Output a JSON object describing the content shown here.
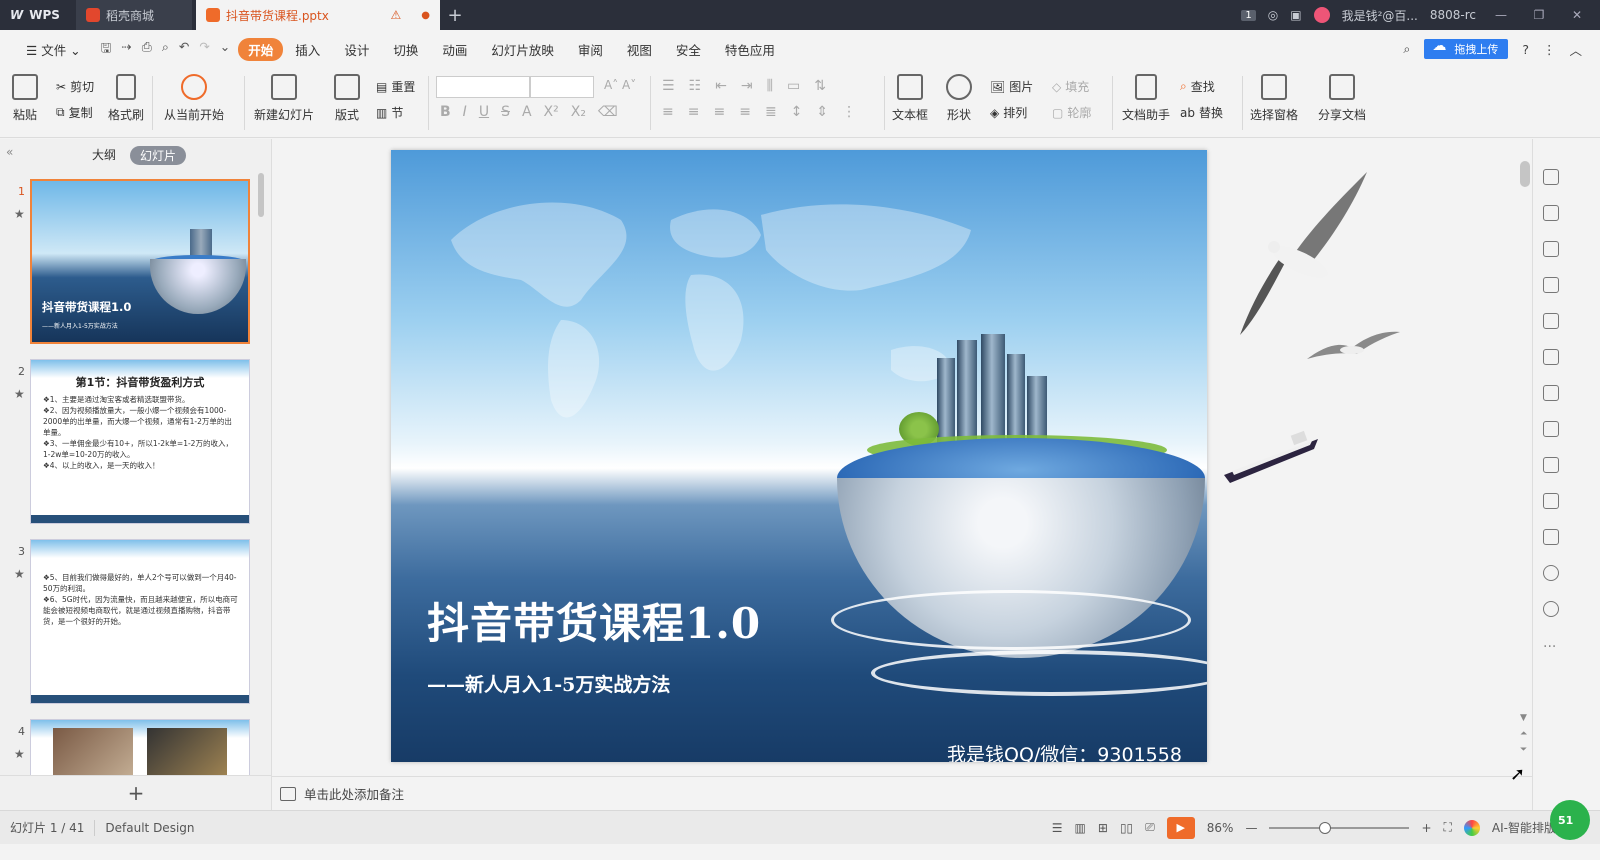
{
  "titlebar": {
    "wps_label": "WPS",
    "tabs": [
      {
        "label": "稻壳商城"
      },
      {
        "label": "抖音带货课程.pptx"
      }
    ],
    "badge": "1",
    "user": "我是钱²@百...",
    "user_id": "8808-rc"
  },
  "menu": {
    "file": "文件",
    "items": [
      "开始",
      "插入",
      "设计",
      "切换",
      "动画",
      "幻灯片放映",
      "审阅",
      "视图",
      "安全",
      "特色应用"
    ],
    "upload": "拖拽上传"
  },
  "ribbon": {
    "paste": "粘贴",
    "cut": "剪切",
    "copy": "复制",
    "format_painter": "格式刷",
    "from_current": "从当前开始",
    "new_slide": "新建幻灯片",
    "layout": "版式",
    "reset": "重置",
    "section": "节",
    "textbox": "文本框",
    "shape": "形状",
    "picture": "图片",
    "fill": "填充",
    "arrange": "排列",
    "outline": "轮廓",
    "doc_assistant": "文档助手",
    "find": "查找",
    "replace": "替换",
    "select_pane": "选择窗格",
    "share_doc": "分享文档"
  },
  "left_panel": {
    "tab_outline": "大纲",
    "tab_slides": "幻灯片",
    "thumbs": [
      {
        "num": "1",
        "title": "抖音带货课程1.0",
        "sub": "——新人月入1-5万实战方法"
      },
      {
        "num": "2",
        "title": "第1节：抖音带货盈利方式",
        "lines": [
          "❖1、主要是通过淘宝客或者精选联盟带货。",
          "❖2、因为视频播放量大，一般小爆一个视频会有1000-2000单的出单量，而大爆一个视频，通常有1-2万单的出单量。",
          "❖3、一单佣金最少有10+，所以1-2k单=1-2万的收入，1-2w单=10-20万的收入。",
          "❖4、以上的收入，是一天的收入！"
        ]
      },
      {
        "num": "3",
        "lines": [
          "❖5、目前我们做得最好的，单人2个号可以做到一个月40-50万的利润。",
          "❖6、5G时代，因为流量快，而且越来越便宜，所以电商可能会被短视频电商取代，就是通过视频直播购物，抖音带货，是一个很好的开始。"
        ]
      },
      {
        "num": "4"
      }
    ]
  },
  "slide": {
    "title": "抖音带货课程1.0",
    "subtitle": "——新人月入1-5万实战方法",
    "contact": "我是钱QQ/微信：9301558"
  },
  "notes": {
    "placeholder": "单击此处添加备注"
  },
  "status": {
    "slide_info": "幻灯片 1 / 41",
    "theme": "Default Design",
    "zoom": "86%",
    "ai_layout": "AI-智能排版",
    "corner": "51"
  }
}
